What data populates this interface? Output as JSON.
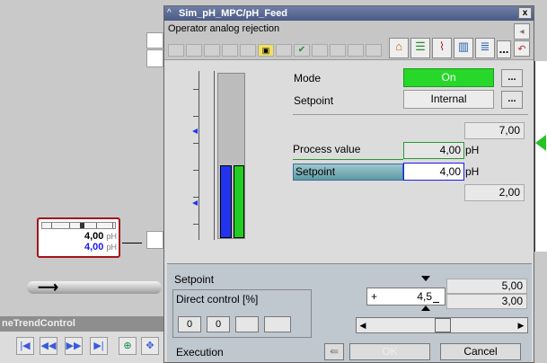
{
  "window": {
    "title": "Sim_pH_MPC/pH_Feed",
    "close_label": "x",
    "title_icon": "^"
  },
  "toolbar": {
    "operator_text": "Operator analog rejection",
    "icons": [
      "lock-icon",
      "checkmark-icon",
      "home-icon",
      "memo-icon",
      "trend-icon",
      "barchart-icon",
      "alarm-list-icon",
      "more-icon",
      "back-icon"
    ],
    "more_label": "..."
  },
  "mode": {
    "label": "Mode",
    "value": "On",
    "value_color": "#27d82a",
    "dots": "..."
  },
  "setpoint_source": {
    "label": "Setpoint",
    "value": "Internal",
    "dots": "..."
  },
  "range": {
    "high": "7,00",
    "low": "2,00"
  },
  "process_value": {
    "label": "Process value",
    "value": "4,00",
    "unit": "pH"
  },
  "setpoint": {
    "label": "Setpoint",
    "value": "4,00",
    "unit": "pH"
  },
  "bar_levels": {
    "pv_fraction": 0.4,
    "sp_fraction": 0.4
  },
  "bottom": {
    "setpoint_label": "Setpoint",
    "direct_control_label": "Direct control [%]",
    "dc_buttons": [
      "0",
      "0",
      "",
      ""
    ],
    "entry_sign": "+",
    "entry_value": "4,5",
    "limit_high": "5,00",
    "limit_low": "3,00",
    "slider_fraction": 0.5
  },
  "execution": {
    "label": "Execution",
    "ok_label": "OK",
    "cancel_label": "Cancel"
  },
  "background": {
    "mini_pv": "4,00",
    "mini_sp": "4,00",
    "mini_unit": "pH",
    "trend_title": "neTrendControl",
    "trend_buttons": [
      "|◀",
      "◀◀",
      "▶▶",
      "▶|",
      "⊕",
      "✥"
    ]
  },
  "colors": {
    "title_bar": "#4a5a84",
    "pv_bar": "#2233ee",
    "sp_bar": "#22cc22",
    "alarm_border": "#a4141c"
  }
}
